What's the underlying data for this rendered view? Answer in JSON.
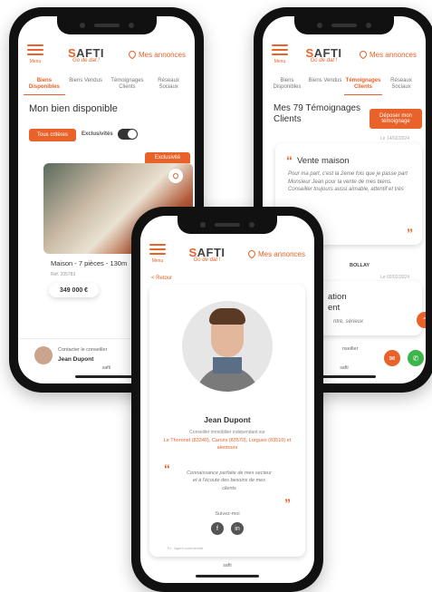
{
  "brand": {
    "name_a": "S",
    "name_b": "AFTI",
    "tagline": "Go de dat !",
    "menu_label": "Menu"
  },
  "nav": {
    "annonces": "Mes annonces"
  },
  "phone1": {
    "tabs": [
      "Biens Disponibles",
      "Biens Vendus",
      "Témoignages Clients",
      "Réseaux Sociaux"
    ],
    "title": "Mon bien disponible",
    "filter_btn": "Tous critères",
    "toggle_label": "Exclusivités",
    "badge": "Exclusivité",
    "property_title": "Maison - 7 pièces - 130m",
    "property_ref": "Réf. 205783",
    "price": "349 000 €",
    "contact_label": "Contacter le conseiller",
    "contact_name": "Jean Dupont",
    "footer_logo": "safti"
  },
  "phone2": {
    "tabs": [
      "Biens Disponibles",
      "Biens Vendus",
      "Témoignages Clients",
      "Réseaux Sociaux"
    ],
    "title": "Mes 79 Témoignages Clients",
    "cta": "Déposer mon témoignage",
    "card_date": "Le 14/02/2024",
    "card_title": "Vente maison",
    "card_text": "Pour ma part, c'est la 2eme fois que je passe part Monsieur Jean pour la vente de mes biens. Conseiller toujours aussi aimable, attentif et très",
    "author": "BOLLAY",
    "date2": "Le 02/02/2024",
    "card2_title_a": "ation",
    "card2_title_b": "ent",
    "card2_text": "ntre, sérieux",
    "bottom_label": "nseiller",
    "footer_logo": "safti"
  },
  "phone3": {
    "back": "< Retour",
    "name": "Jean Dupont",
    "role": "Conseiller immobilier indépendant sur",
    "cities": "Le Thoronet (83340), Carcès (83570), Lorgues (83510) et alentours",
    "quote": "Connaissance parfaite de mes secteur et à l'écoute des besoins de mes clients",
    "follow": "Suivez-moi",
    "social": [
      "f",
      "in"
    ],
    "legal": "EI - Agent commercial",
    "footer_logo": "safti"
  },
  "colors": {
    "accent": "#e8622a",
    "call": "#3db54a"
  }
}
